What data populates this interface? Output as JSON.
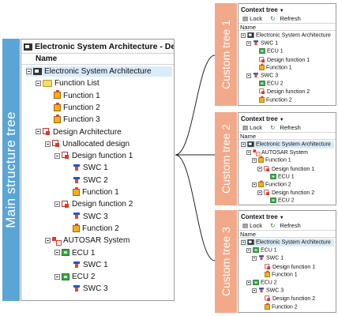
{
  "main": {
    "side_label": "Main structure tree",
    "title": "Electronic System Architecture - Defau",
    "column_name": "Name",
    "rows": [
      {
        "label": "Electronic System Architecture",
        "icon": "system",
        "level": 0,
        "toggle": true,
        "selected": true
      },
      {
        "label": "Function List",
        "icon": "folder",
        "level": 1,
        "toggle": true
      },
      {
        "label": "Function 1",
        "icon": "function",
        "level": 2
      },
      {
        "label": "Function 2",
        "icon": "function",
        "level": 2
      },
      {
        "label": "Function 3",
        "icon": "function",
        "level": 2
      },
      {
        "label": "Design Architecture",
        "icon": "design",
        "level": 1,
        "toggle": true
      },
      {
        "label": "Unallocated design",
        "icon": "design",
        "level": 2,
        "toggle": true
      },
      {
        "label": "Design function 1",
        "icon": "design",
        "level": 3,
        "toggle": true
      },
      {
        "label": "SWC 1",
        "icon": "swc",
        "level": 4
      },
      {
        "label": "SWC 2",
        "icon": "swc",
        "level": 4
      },
      {
        "label": "Function 1",
        "icon": "function",
        "level": 4
      },
      {
        "label": "Design function 2",
        "icon": "design",
        "level": 3,
        "toggle": true
      },
      {
        "label": "SWC 3",
        "icon": "swc",
        "level": 4
      },
      {
        "label": "Function 2",
        "icon": "function",
        "level": 4
      },
      {
        "label": "AUTOSAR System",
        "icon": "autosar",
        "level": 2,
        "toggle": true
      },
      {
        "label": "ECU 1",
        "icon": "ecu",
        "level": 3,
        "toggle": true
      },
      {
        "label": "SWC 1",
        "icon": "swc",
        "level": 4
      },
      {
        "label": "ECU 2",
        "icon": "ecu",
        "level": 3,
        "toggle": true
      },
      {
        "label": "SWC 3",
        "icon": "swc",
        "level": 4
      }
    ]
  },
  "custom_trees": [
    {
      "tab_label": "Custom tree 1",
      "title": "Context tree",
      "lock": "Lock",
      "refresh": "Refresh",
      "column_name": "Name",
      "rows": [
        {
          "label": "Electronic System Architecture",
          "icon": "system",
          "level": 0,
          "toggle": true
        },
        {
          "label": "SWC 1",
          "icon": "swc",
          "level": 1,
          "toggle": true
        },
        {
          "label": "ECU 1",
          "icon": "ecu",
          "level": 2
        },
        {
          "label": "Design function 1",
          "icon": "design",
          "level": 2
        },
        {
          "label": "Function 1",
          "icon": "function",
          "level": 2
        },
        {
          "label": "SWC 3",
          "icon": "swc",
          "level": 1,
          "toggle": true
        },
        {
          "label": "ECU 2",
          "icon": "ecu",
          "level": 2
        },
        {
          "label": "Design function 2",
          "icon": "design",
          "level": 2
        },
        {
          "label": "Function 2",
          "icon": "function",
          "level": 2
        }
      ]
    },
    {
      "tab_label": "Custom tree 2",
      "title": "Context tree",
      "lock": "Lock",
      "refresh": "Refresh",
      "column_name": "Name",
      "rows": [
        {
          "label": "Electronic System Architecture",
          "icon": "system",
          "level": 0,
          "toggle": true,
          "selected": true
        },
        {
          "label": "AUTOSAR System",
          "icon": "autosar",
          "level": 1,
          "toggle": true
        },
        {
          "label": "Function 1",
          "icon": "function",
          "level": 2,
          "toggle": true
        },
        {
          "label": "Design function 1",
          "icon": "design",
          "level": 3,
          "toggle": true
        },
        {
          "label": "ECU 1",
          "icon": "ecu",
          "level": 4
        },
        {
          "label": "Function 2",
          "icon": "function",
          "level": 2,
          "toggle": true
        },
        {
          "label": "Design function 2",
          "icon": "design",
          "level": 3,
          "toggle": true
        },
        {
          "label": "ECU 2",
          "icon": "ecu",
          "level": 4
        }
      ]
    },
    {
      "tab_label": "Custom tree 3",
      "title": "Context tree",
      "lock": "Lock",
      "refresh": "Refresh",
      "column_name": "Name",
      "rows": [
        {
          "label": "Electronic System Architecture",
          "icon": "system",
          "level": 0,
          "toggle": true,
          "selected": true
        },
        {
          "label": "ECU 1",
          "icon": "ecu",
          "level": 1,
          "toggle": true
        },
        {
          "label": "SWC 1",
          "icon": "swc",
          "level": 2,
          "toggle": true
        },
        {
          "label": "Design function 1",
          "icon": "design",
          "level": 3
        },
        {
          "label": "Function 1",
          "icon": "function",
          "level": 3
        },
        {
          "label": "ECU 2",
          "icon": "ecu",
          "level": 1,
          "toggle": true
        },
        {
          "label": "SWC 3",
          "icon": "swc",
          "level": 2,
          "toggle": true
        },
        {
          "label": "Design function 2",
          "icon": "design",
          "level": 3
        },
        {
          "label": "Function 2",
          "icon": "function",
          "level": 3
        }
      ]
    }
  ],
  "colors": {
    "main_accent": "#5aa5d6",
    "custom_accent": "#f2a989",
    "selection": "#d9ecf8"
  }
}
